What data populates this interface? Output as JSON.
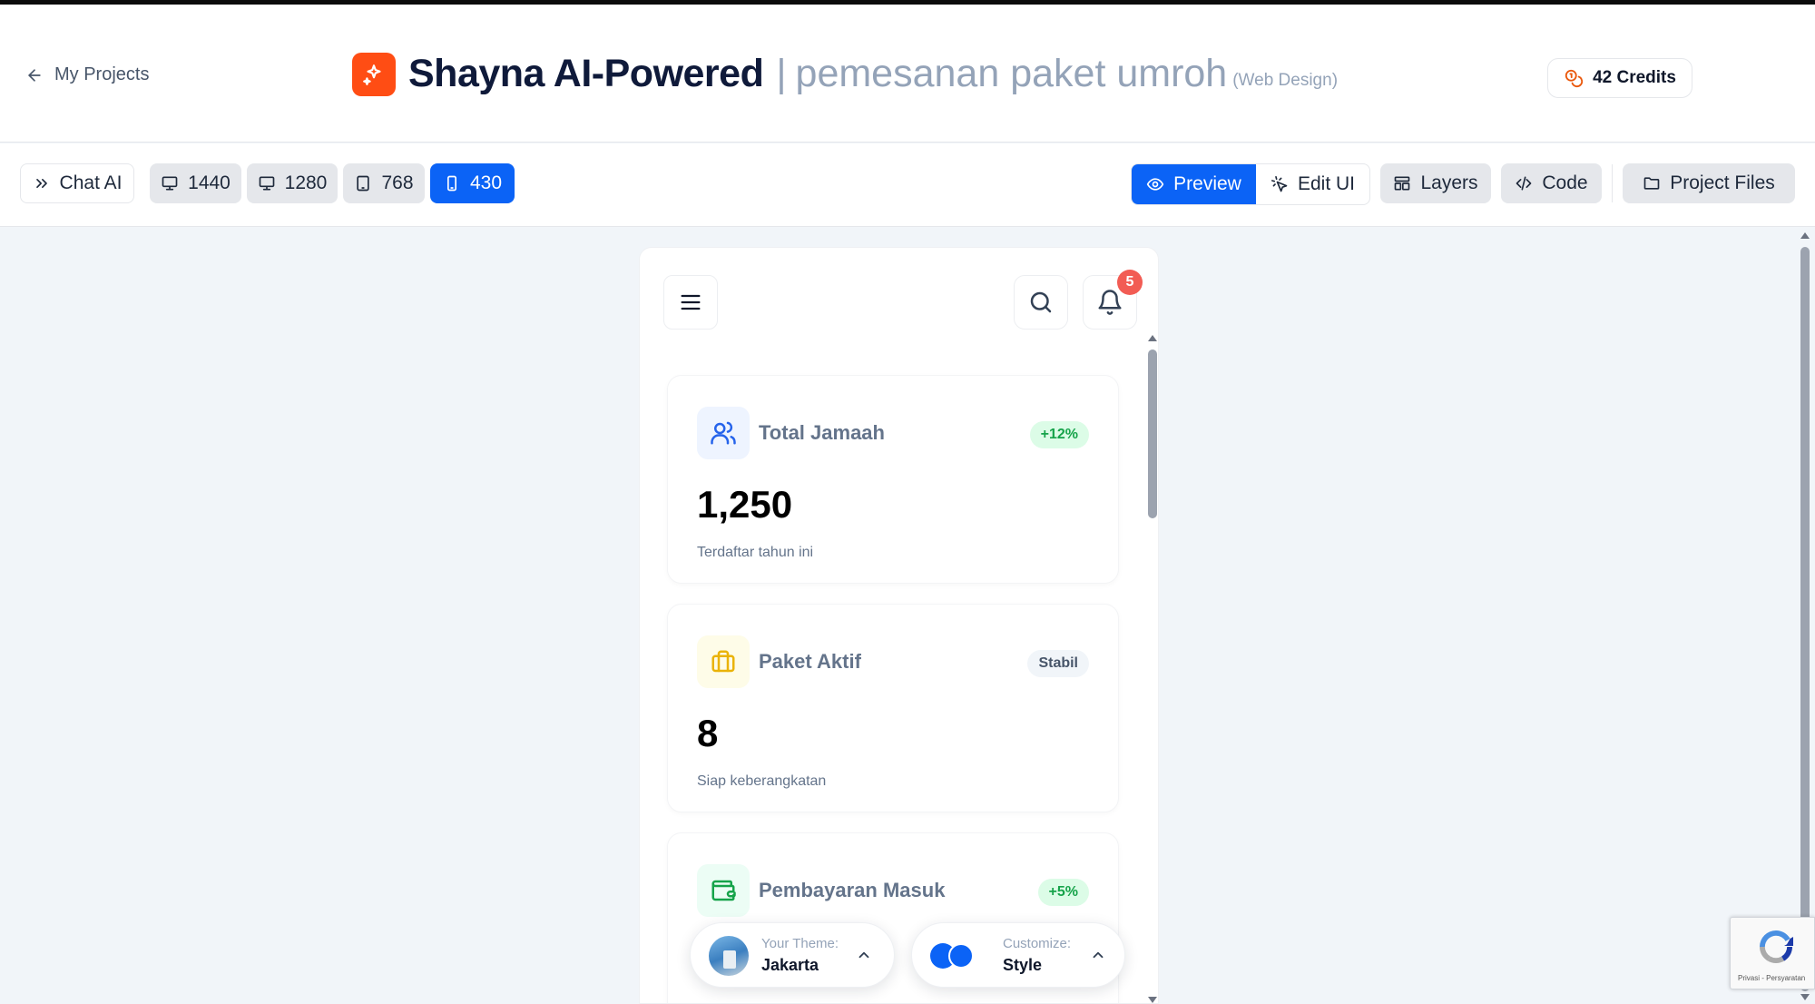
{
  "header": {
    "back_label": "My Projects",
    "title_main": "Shayna AI-Powered",
    "title_separator": "|",
    "title_sub": "pemesanan paket umroh",
    "title_tag": "(Web Design)",
    "credits_label": "42 Credits",
    "brand_color": "#ff4d14"
  },
  "toolbar": {
    "chat_label": "Chat AI",
    "sizes": [
      {
        "label": "1440",
        "icon": "desktop-icon",
        "active": false
      },
      {
        "label": "1280",
        "icon": "desktop-icon",
        "active": false
      },
      {
        "label": "768",
        "icon": "tablet-icon",
        "active": false
      },
      {
        "label": "430",
        "icon": "mobile-icon",
        "active": true
      }
    ],
    "preview_label": "Preview",
    "edit_label": "Edit UI",
    "layers_label": "Layers",
    "code_label": "Code",
    "files_label": "Project Files",
    "accent_color": "#0b63f6"
  },
  "preview": {
    "notification_count": "5",
    "cards": [
      {
        "label": "Total Jamaah",
        "badge": "+12%",
        "value": "1,250",
        "caption": "Terdaftar tahun ini",
        "icon": "users-icon",
        "icon_color": "#2563eb",
        "icon_bg": "#eef4ff",
        "badge_color": "#16a34a",
        "badge_bg": "#dcfce7"
      },
      {
        "label": "Paket Aktif",
        "badge": "Stabil",
        "value": "8",
        "caption": "Siap keberangkatan",
        "icon": "briefcase-icon",
        "icon_color": "#eab308",
        "icon_bg": "#fefce8",
        "badge_color": "#475569",
        "badge_bg": "#f1f5f9"
      },
      {
        "label": "Pembayaran Masuk",
        "badge": "+5%",
        "value": "",
        "caption": "",
        "icon": "wallet-icon",
        "icon_color": "#16a34a",
        "icon_bg": "#ecfdf5",
        "badge_color": "#16a34a",
        "badge_bg": "#dcfce7"
      }
    ]
  },
  "theme_picker": {
    "caption": "Your Theme:",
    "value": "Jakarta"
  },
  "style_picker": {
    "caption": "Customize:",
    "value": "Style"
  },
  "recaptcha": {
    "footer": "Privasi - Persyaratan"
  }
}
